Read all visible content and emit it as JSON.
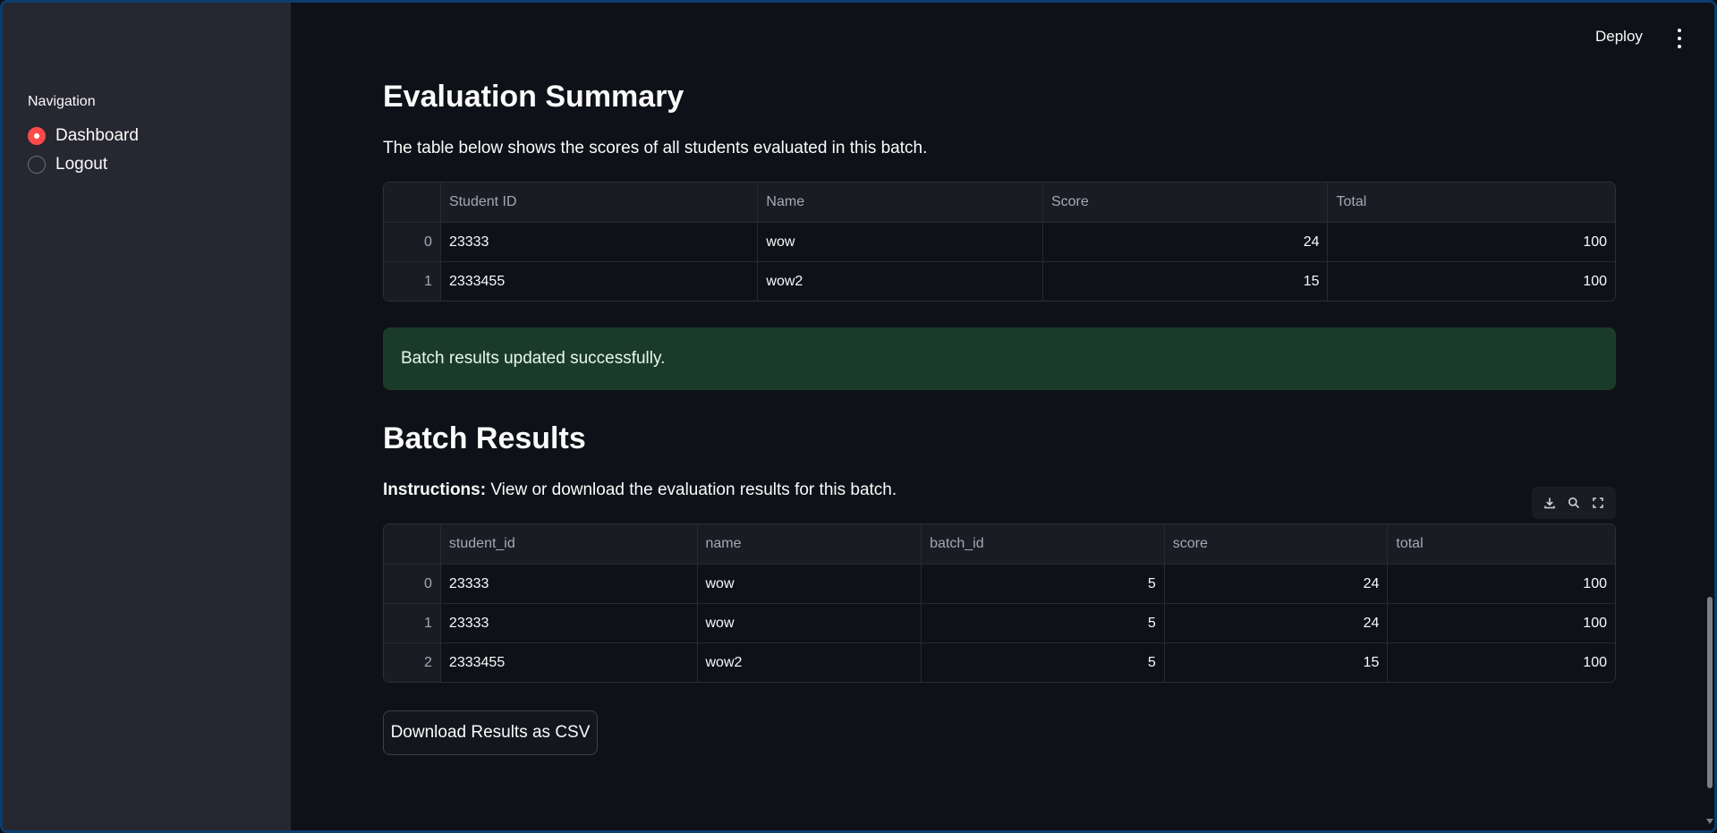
{
  "topbar": {
    "deploy_label": "Deploy",
    "menu_icon": "vertical-dots-icon"
  },
  "sidebar": {
    "heading": "Navigation",
    "options": [
      {
        "label": "Dashboard",
        "selected": true
      },
      {
        "label": "Logout",
        "selected": false
      }
    ]
  },
  "summary": {
    "title": "Evaluation Summary",
    "description": "The table below shows the scores of all students evaluated in this batch.",
    "columns": [
      "",
      "Student ID",
      "Name",
      "Score",
      "Total"
    ],
    "rows": [
      [
        "0",
        "23333",
        "wow",
        "24",
        "100"
      ],
      [
        "1",
        "2333455",
        "wow2",
        "15",
        "100"
      ]
    ]
  },
  "alert": {
    "message": "Batch results updated successfully.",
    "color": "#1b3b2a"
  },
  "batch": {
    "title": "Batch Results",
    "instructions_label": "Instructions:",
    "instructions_text": " View or download the evaluation results for this batch.",
    "toolbar_icons": [
      "download-icon",
      "search-icon",
      "fullscreen-icon"
    ],
    "columns": [
      "",
      "student_id",
      "name",
      "batch_id",
      "score",
      "total"
    ],
    "rows": [
      [
        "0",
        "23333",
        "wow",
        "5",
        "24",
        "100"
      ],
      [
        "1",
        "23333",
        "wow",
        "5",
        "24",
        "100"
      ],
      [
        "2",
        "2333455",
        "wow2",
        "5",
        "15",
        "100"
      ]
    ],
    "download_label": "Download Results as CSV"
  },
  "accent_color": "#ff4b4b"
}
